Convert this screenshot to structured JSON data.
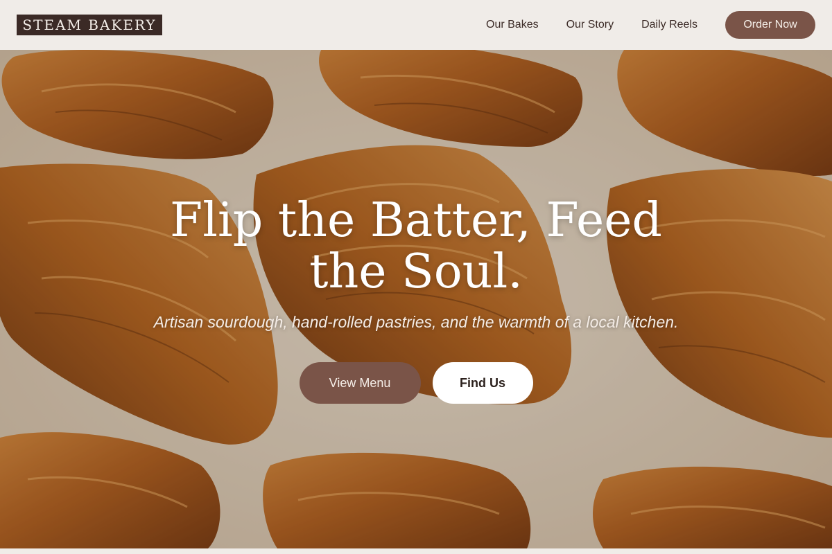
{
  "header": {
    "logo": "STEAM BAKERY",
    "nav": [
      {
        "label": "Our Bakes"
      },
      {
        "label": "Our Story"
      },
      {
        "label": "Daily Reels"
      }
    ],
    "cta_label": "Order Now"
  },
  "hero": {
    "headline": "Flip the Batter, Feed the Soul.",
    "tagline": "Artisan sourdough, hand-rolled pastries, and the warmth of a local kitchen.",
    "primary_button": "View Menu",
    "secondary_button": "Find Us",
    "background": "photo of golden croissants on parchment"
  },
  "colors": {
    "accent": "#7a5448",
    "logo_bg": "#3b2a26",
    "header_bg": "#f0ece8",
    "text_dark": "#3b2a26"
  }
}
